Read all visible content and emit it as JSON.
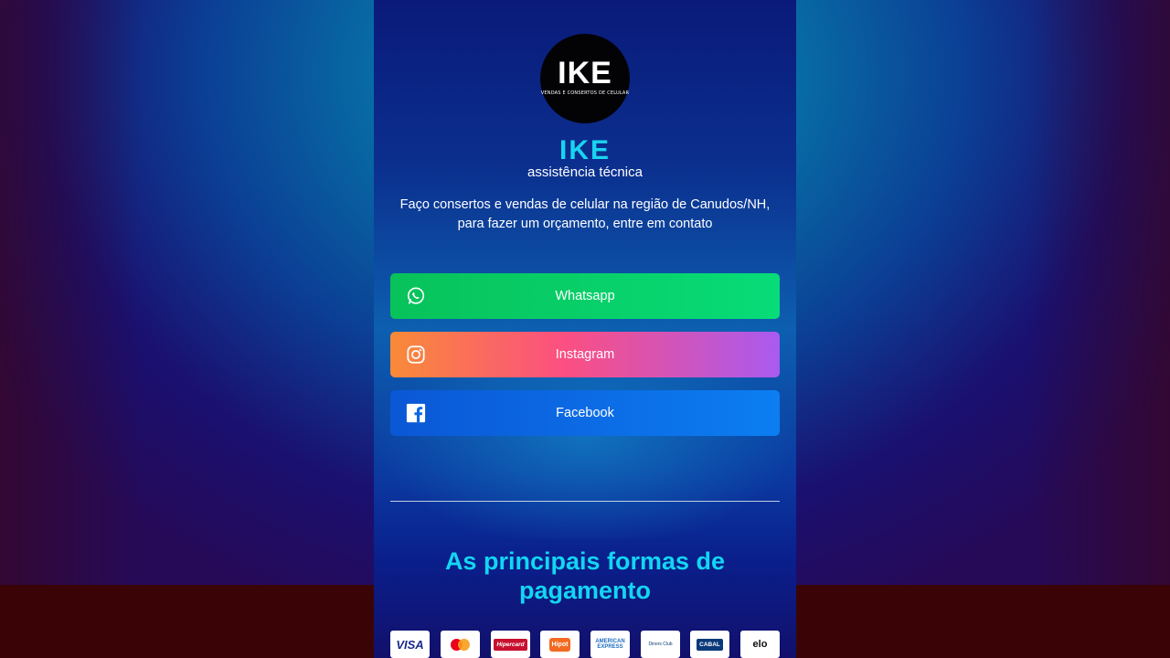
{
  "logo": {
    "mark": "IKE",
    "tagline": "VENDAS E CONSERTOS DE CELULAR"
  },
  "brand": {
    "name": "IKE",
    "subtitle": "assistência técnica"
  },
  "description": {
    "line1": "Faço consertos e vendas de celular na região de Canudos/NH,",
    "line2": "para fazer um orçamento, entre em contato"
  },
  "links": [
    {
      "label": "Whatsapp",
      "icon": "whatsapp-icon"
    },
    {
      "label": "Instagram",
      "icon": "instagram-icon"
    },
    {
      "label": "Facebook",
      "icon": "facebook-icon"
    }
  ],
  "payments": {
    "title_line1": "As principais formas de",
    "title_line2": "pagamento",
    "cards": [
      "VISA",
      "Mastercard",
      "Hipercard",
      "Hipot",
      "AMERICAN EXPRESS",
      "Diners Club",
      "CABAL",
      "elo"
    ]
  },
  "colors": {
    "whatsapp": "#07c864",
    "instagram": "#fb4f82",
    "facebook": "#0b6ee6",
    "accent": "#19d4f0"
  }
}
